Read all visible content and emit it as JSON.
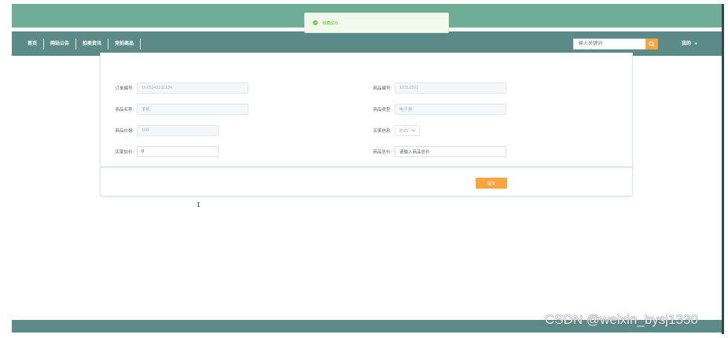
{
  "toast": {
    "message": "收藏成功",
    "icon": "check-circle-icon"
  },
  "nav": {
    "items": [
      {
        "label": "首页"
      },
      {
        "label": "网站公告"
      },
      {
        "label": "拍卖资讯"
      },
      {
        "label": "竞拍商品"
      }
    ],
    "search_placeholder": "输入关键词",
    "search_icon": "search-icon",
    "user_label": "我的",
    "user_caret": "▾"
  },
  "form": {
    "order_no": {
      "label": "订单编号:",
      "value": "1673343211134"
    },
    "goods_no": {
      "label": "商品编号:",
      "value": "12312321"
    },
    "goods_name": {
      "label": "商品名称:",
      "value": "手机"
    },
    "goods_type": {
      "label": "商品类型:",
      "value": "电子类"
    },
    "goods_price": {
      "label": "商品价格:",
      "value": "100"
    },
    "buyer_info": {
      "label": "买家信息:",
      "value": "测试1"
    },
    "buyer_bid": {
      "label": "买家加价:",
      "value": "0"
    },
    "goods_total": {
      "label": "商品总价:",
      "placeholder": "请输入商品总价"
    },
    "submit_label": "提交"
  },
  "colors": {
    "accent": "#f7a540",
    "navbar": "#5c8a88",
    "top_strip": "#6fae95",
    "success": "#67c23a"
  },
  "watermark": "CSDN @weixin_bysj1330"
}
